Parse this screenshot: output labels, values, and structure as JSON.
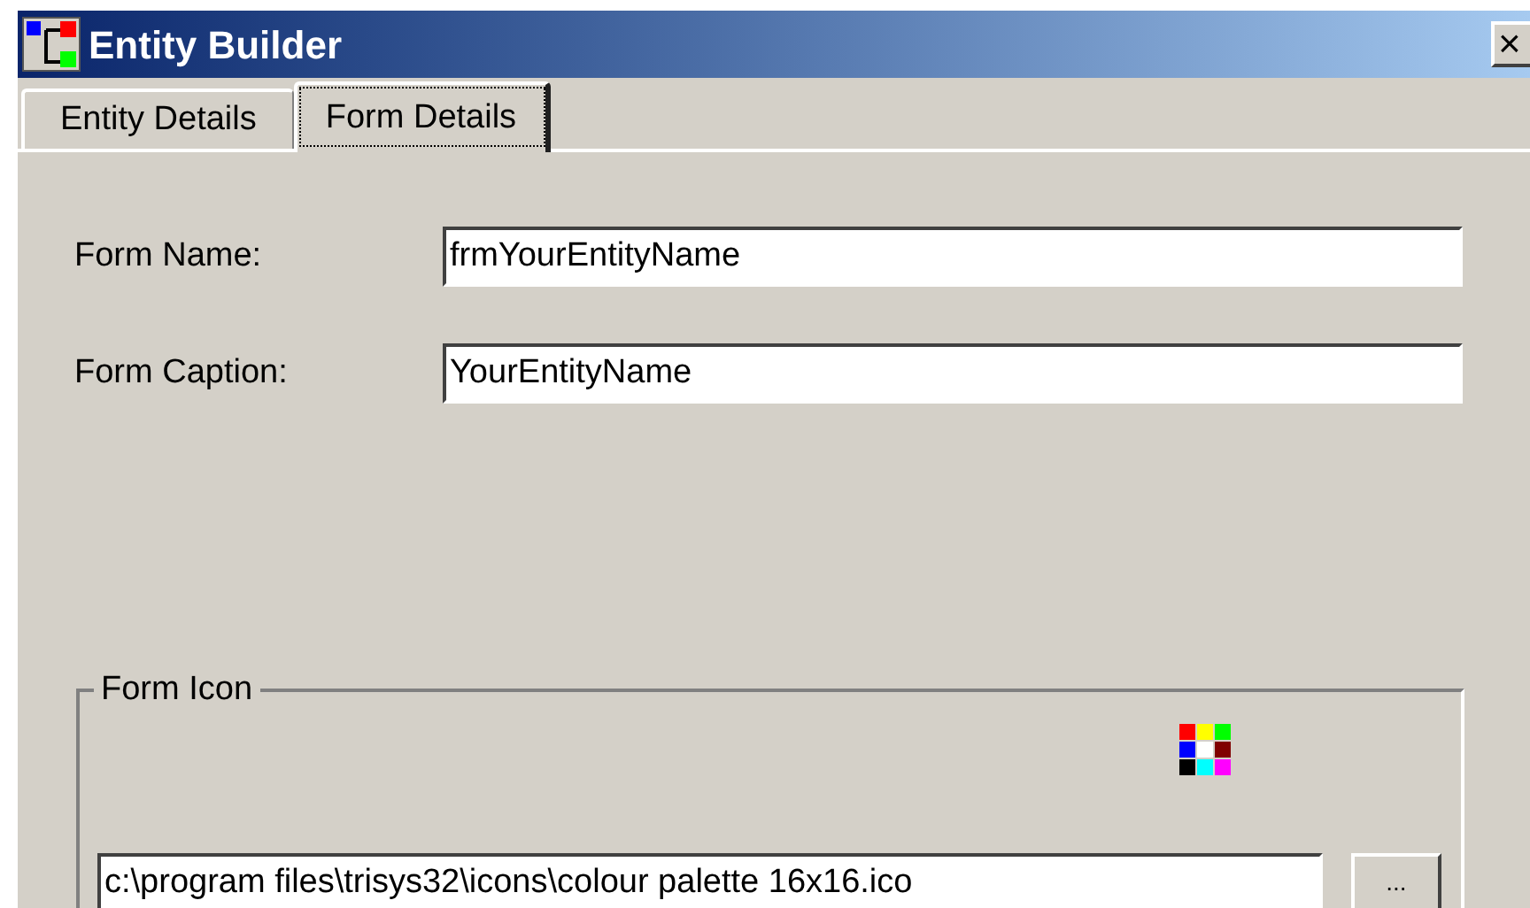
{
  "window": {
    "title": "Entity Builder",
    "close": "×"
  },
  "tabs": [
    {
      "label": "Entity Details",
      "selected": false
    },
    {
      "label": "Form Details",
      "selected": true
    }
  ],
  "fields": [
    {
      "label": "Form Name:",
      "value": "frmYourEntityName"
    },
    {
      "label": "Form Caption:",
      "value": "YourEntityName"
    }
  ],
  "form_icon": {
    "legend": "Form Icon",
    "path": "c:\\program files\\trisys32\\icons\\colour palette 16x16.ico",
    "browse": "..."
  }
}
